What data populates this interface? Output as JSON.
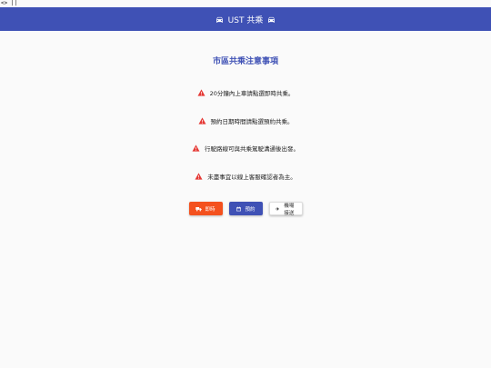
{
  "code_fragment": "<> ||",
  "header": {
    "title": "UST 共乘",
    "left_icon": "car-icon",
    "right_icon": "car-icon",
    "background_color": "#3f51b5",
    "text_color": "#ffffff"
  },
  "notice": {
    "title": "市區共乘注意事項",
    "icon": "warning-icon",
    "icon_color": "#e53935",
    "items": [
      "20分鐘內上車請點選即時共乘。",
      "預約日期時間請點選預約共乘。",
      "行駛路線可與共乘駕駛溝通後出發。",
      "未盡事宜以線上客服確認者為主。"
    ]
  },
  "buttons": {
    "carpool": {
      "label": "即時",
      "icon": "truck-icon",
      "color": "#f4511e"
    },
    "reserve": {
      "label": "預約",
      "icon": "calendar-icon",
      "color": "#3f51b5"
    },
    "airport": {
      "label": "機場接送",
      "icon": "airplane-icon",
      "color": "#ffffff"
    }
  }
}
